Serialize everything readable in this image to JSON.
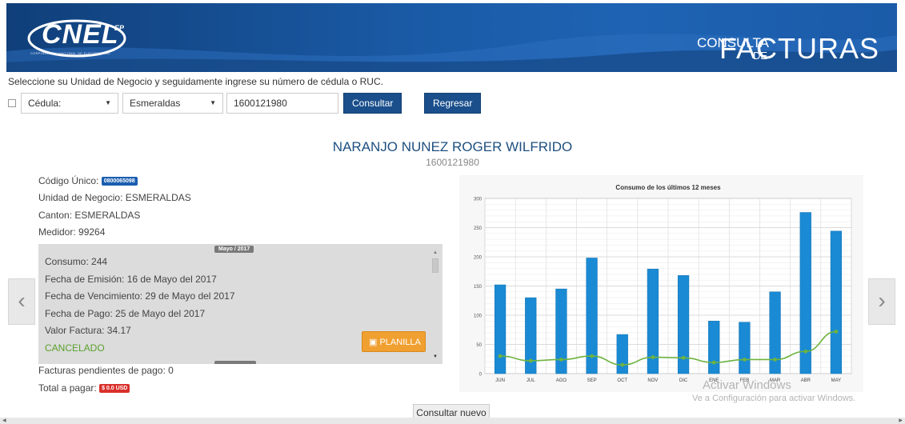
{
  "header": {
    "logo_main": "CNEL",
    "logo_ep": "EP",
    "logo_sub": "CORPORACIÓN NACIONAL DE ELECTRICIDAD",
    "title_top": "CONSULTA",
    "title_de": "DE",
    "title_main": "FACTURAS"
  },
  "instructions": "Seleccione su Unidad de Negocio y seguidamente ingrese su número de cédula o RUC.",
  "controls": {
    "id_type": "Cédula:",
    "unit": "Esmeraldas",
    "id_value": "1600121980",
    "consult_label": "Consultar",
    "back_label": "Regresar"
  },
  "client": {
    "name": "NARANJO NUNEZ ROGER WILFRIDO",
    "cedula": "1600121980",
    "codigo_label": "Código Único:",
    "codigo_value": "0800065098",
    "unidad": "Unidad de Negocio: ESMERALDAS",
    "canton": "Canton: ESMERALDAS",
    "medidor": "Medidor: 99264"
  },
  "invoice": {
    "month": "Mayo / 2017",
    "consumo": "Consumo: 244",
    "emision": "Fecha de Emisión: 16 de Mayo del 2017",
    "vencimiento": "Fecha de Vencimiento: 29 de Mayo del 2017",
    "pago": "Fecha de Pago: 25 de Mayo del 2017",
    "valor": "Valor Factura: 34.17",
    "estado": "CANCELADO",
    "planilla_label": "PLANILLA"
  },
  "summary": {
    "pendientes": "Facturas pendientes de pago: 0",
    "total_label": "Total a pagar:",
    "total_value": "$ 0.0 USD"
  },
  "consult_new_label": "Consultar nuevo",
  "watermark": {
    "line1": "Activar Windows",
    "line2": "Ve a Configuración para activar Windows."
  },
  "colors": {
    "bar": "#1a8ad4",
    "line": "#6db33f",
    "header": "#1a5aa5",
    "button": "#1a4f8c",
    "planilla": "#f0a030"
  },
  "chart_data": {
    "type": "bar",
    "title": "Consumo de los últimos 12 meses",
    "categories": [
      "JUN",
      "JUL",
      "AGO",
      "SEP",
      "OCT",
      "NOV",
      "DIC",
      "ENE",
      "FEB",
      "MAR",
      "ABR",
      "MAY"
    ],
    "series": [
      {
        "type": "bar",
        "values": [
          152,
          130,
          145,
          198,
          67,
          179,
          168,
          90,
          88,
          140,
          276,
          244
        ]
      },
      {
        "type": "line",
        "values": [
          30,
          22,
          24,
          30,
          15,
          28,
          27,
          19,
          24,
          24,
          38,
          72
        ]
      }
    ],
    "ylim": [
      0,
      300
    ],
    "yticks": [
      0,
      50,
      100,
      150,
      200,
      250,
      300
    ],
    "grid": true
  }
}
